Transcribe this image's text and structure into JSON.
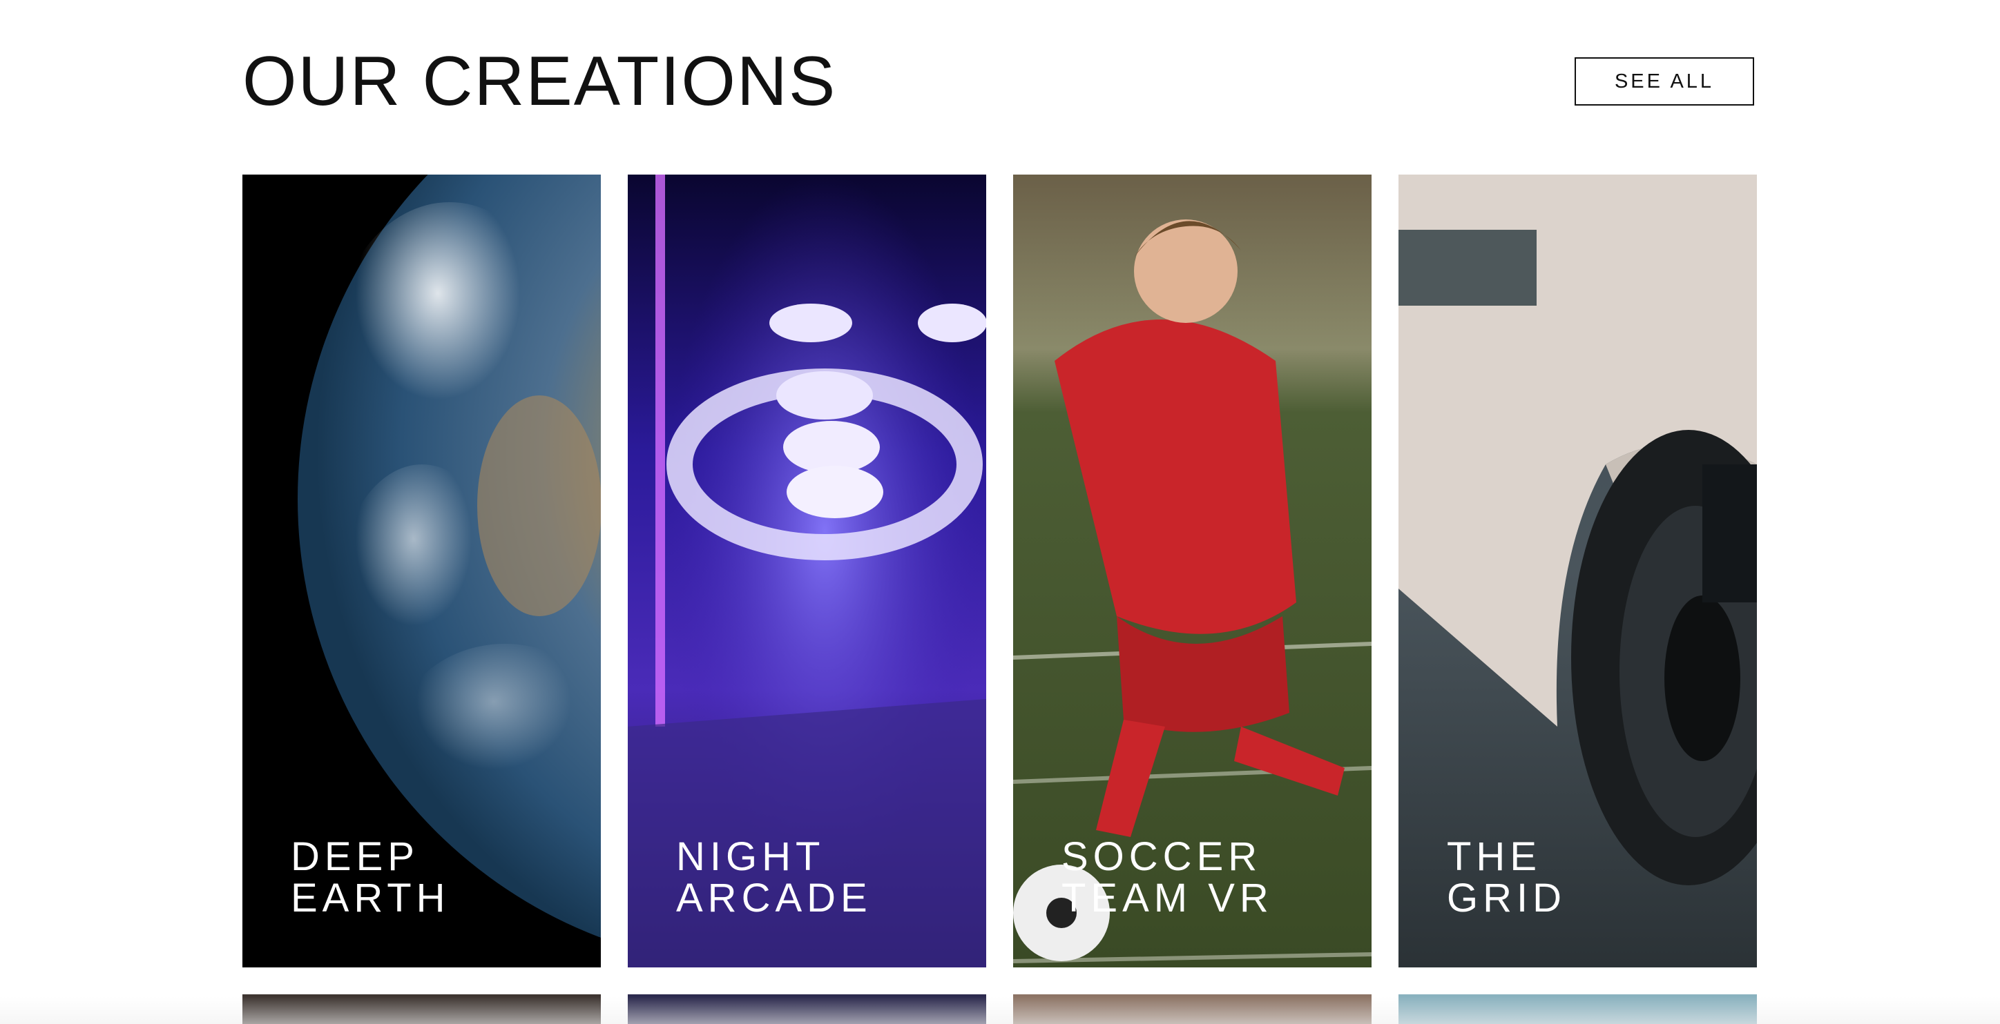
{
  "section": {
    "title": "OUR CREATIONS",
    "see_all_label": "SEE ALL"
  },
  "cards": [
    {
      "title_line1": "DEEP",
      "title_line2": "EARTH",
      "image": "earth-from-space"
    },
    {
      "title_line1": "NIGHT",
      "title_line2": "ARCADE",
      "image": "neon-skee-ball-targets"
    },
    {
      "title_line1": "SOCCER",
      "title_line2": "TEAM VR",
      "image": "soccer-player-red-kit"
    },
    {
      "title_line1": "THE",
      "title_line2": "GRID",
      "image": "race-car-wheel"
    }
  ],
  "cards_row2": [
    {
      "image": "dark-texture"
    },
    {
      "image": "starry-sky"
    },
    {
      "image": "brown-surface"
    },
    {
      "image": "blue-sky"
    }
  ],
  "colors": {
    "text": "#111111",
    "card_text": "#ffffff"
  }
}
